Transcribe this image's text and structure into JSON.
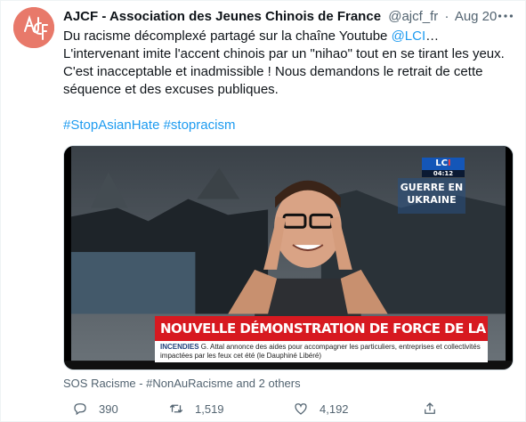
{
  "tweet": {
    "author": {
      "name": "AJCF - Association des Jeunes Chinois de France",
      "handle": "@ajcf_fr",
      "avatar_logo_text": "AJCF"
    },
    "separator": "·",
    "date": "Aug 20",
    "text": {
      "part1": "Du racisme décomplexé partagé sur la chaîne Youtube ",
      "mention": "@LCI",
      "part2": "… L'intervenant imite l'accent chinois par un \"nihao\" tout en se tirant les yeux. C'est inacceptable et inadmissible ! Nous demandons le retrait de cette séquence et des excuses publiques.",
      "hashtag1": "#StopAsianHate",
      "hashtag2": "#stopracism"
    },
    "media": {
      "channel_logo_left": "LC",
      "channel_logo_right": "I",
      "channel_time": "04:12",
      "topic_line1": "GUERRE EN",
      "topic_line2": "UKRAINE",
      "headline": "NOUVELLE DÉMONSTRATION DE FORCE DE LA CHINE",
      "subtitle_label": "INCENDIES",
      "subtitle_text": " G. Attal annonce des aides pour accompagner les particuliers, entreprises et collectivités impactées par les feux cet été (le Dauphiné Libéré)"
    },
    "social_context": "SOS Racisme - #NonAuRacisme and 2 others",
    "actions": {
      "reply_count": "390",
      "retweet_count": "1,519",
      "like_count": "4,192"
    },
    "colors": {
      "link": "#1d9bf0",
      "secondary_text": "#536471",
      "avatar_bg": "#e8796a",
      "headline_red": "#d71920"
    },
    "icons": [
      "more-icon",
      "reply-icon",
      "retweet-icon",
      "like-icon",
      "share-icon"
    ]
  }
}
